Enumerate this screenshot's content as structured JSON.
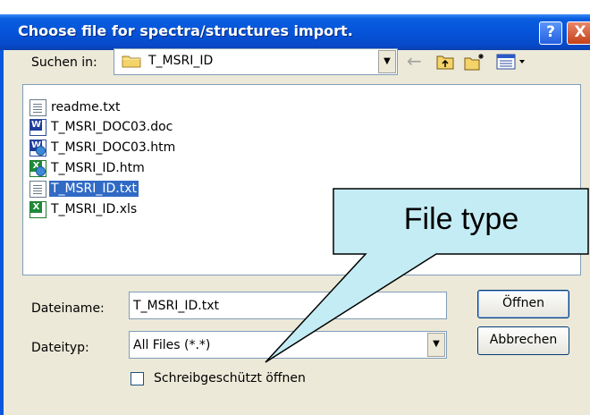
{
  "window": {
    "title": "Choose file for spectra/structures import.",
    "help_glyph": "?",
    "close_glyph": "X"
  },
  "lookin": {
    "label": "Suchen in:",
    "value": "T_MSRI_ID",
    "folder_icon": "folder-icon"
  },
  "toolbar": {
    "back_icon": "back-arrow-icon",
    "up_icon": "up-folder-icon",
    "new_folder_icon": "new-folder-icon",
    "views_icon": "views-menu-icon"
  },
  "files": [
    {
      "name": "readme.txt",
      "icon": "text-file-icon"
    },
    {
      "name": "T_MSRI_DOC03.doc",
      "icon": "word-document-icon"
    },
    {
      "name": "T_MSRI_DOC03.htm",
      "icon": "word-html-icon"
    },
    {
      "name": "T_MSRI_ID.htm",
      "icon": "excel-html-icon"
    },
    {
      "name": "T_MSRI_ID.txt",
      "icon": "text-file-icon",
      "selected": true
    },
    {
      "name": "T_MSRI_ID.xls",
      "icon": "excel-workbook-icon"
    }
  ],
  "filename": {
    "label": "Dateiname:",
    "value": "T_MSRI_ID.txt"
  },
  "filetype": {
    "label": "Dateityp:",
    "value": "All Files (*.*)"
  },
  "buttons": {
    "open": "Öffnen",
    "cancel": "Abbrechen"
  },
  "readonly": {
    "label": "Schreibgeschützt öffnen",
    "checked": false
  },
  "callout": {
    "text": "File type"
  },
  "colors": {
    "titlebar": "#0554d9",
    "dialog_bg": "#ece9d8",
    "selection": "#316ac5",
    "callout_fill": "#c4ecf4"
  }
}
